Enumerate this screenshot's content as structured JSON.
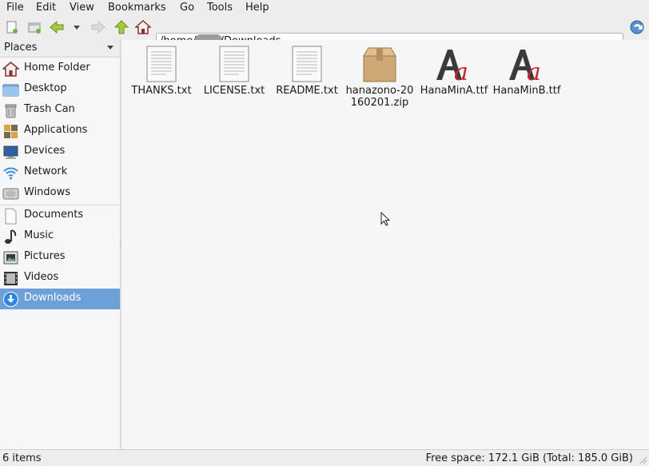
{
  "menubar": {
    "items": [
      "File",
      "Edit",
      "View",
      "Bookmarks",
      "Go",
      "Tools",
      "Help"
    ]
  },
  "toolbar": {
    "path_prefix": "/home/",
    "path_suffix": "/Downloads",
    "buttons": [
      "new-tab-icon",
      "new-window-icon",
      "back-icon",
      "history-dropdown-icon",
      "forward-icon",
      "up-icon",
      "home-icon",
      "go-icon"
    ]
  },
  "sidebar": {
    "header": "Places",
    "items": [
      {
        "label": "Home Folder",
        "icon": "home-icon"
      },
      {
        "label": "Desktop",
        "icon": "desktop-folder-icon"
      },
      {
        "label": "Trash Can",
        "icon": "trash-icon"
      },
      {
        "label": "Applications",
        "icon": "applications-icon"
      },
      {
        "label": "Devices",
        "icon": "computer-icon"
      },
      {
        "label": "Network",
        "icon": "network-icon"
      },
      {
        "label": "Windows",
        "icon": "drive-icon"
      },
      {
        "label": "Documents",
        "icon": "document-icon"
      },
      {
        "label": "Music",
        "icon": "music-icon"
      },
      {
        "label": "Pictures",
        "icon": "pictures-icon"
      },
      {
        "label": "Videos",
        "icon": "videos-icon"
      },
      {
        "label": "Downloads",
        "icon": "downloads-icon",
        "selected": true
      }
    ]
  },
  "files": [
    {
      "name": "THANKS.txt",
      "icon": "text-file-icon"
    },
    {
      "name": "LICENSE.txt",
      "icon": "text-file-icon"
    },
    {
      "name": "README.txt",
      "icon": "text-file-icon"
    },
    {
      "name": "hanazono-20160201.zip",
      "icon": "archive-icon"
    },
    {
      "name": "HanaMinA.ttf",
      "icon": "font-file-icon"
    },
    {
      "name": "HanaMinB.ttf",
      "icon": "font-file-icon"
    }
  ],
  "statusbar": {
    "items_count": "6 items",
    "free_space": "Free space: 172.1 GiB (Total: 185.0 GiB)"
  },
  "colors": {
    "selection": "#6d9fd8",
    "window_bg": "#ededed"
  }
}
